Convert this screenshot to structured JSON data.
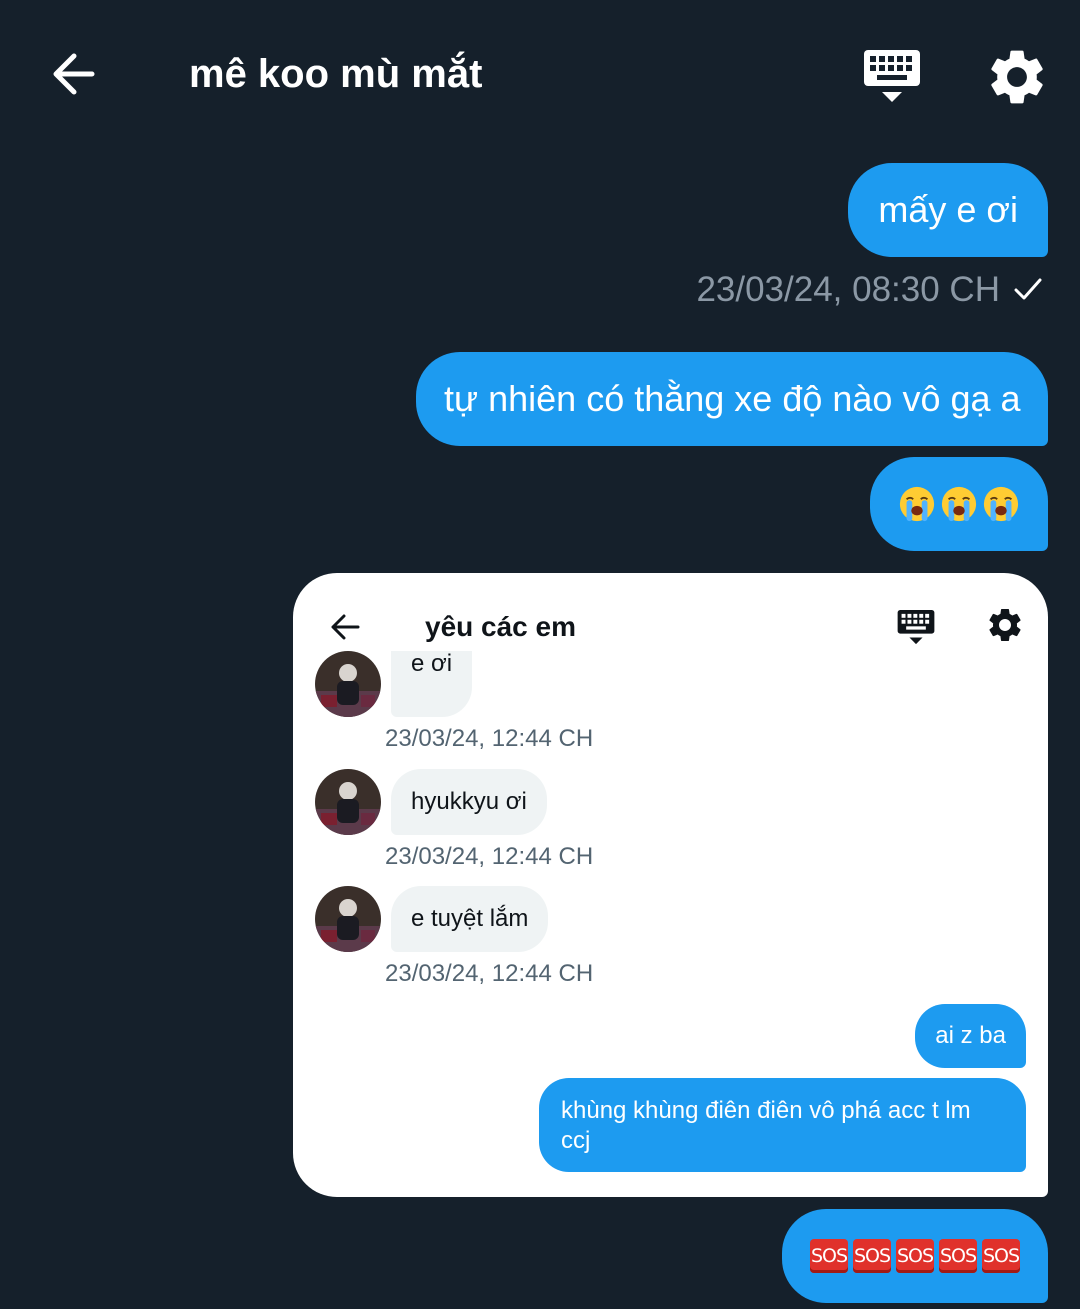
{
  "header": {
    "title": "mê koo mù mắt",
    "back_icon": "arrow-left-icon",
    "keyboard_icon": "keyboard-icon",
    "settings_icon": "gear-icon"
  },
  "messages": [
    {
      "text": "mấy e ơi"
    },
    {
      "timestamp": "23/03/24, 08:30 CH",
      "status_icon": "check-icon"
    },
    {
      "text": "tự nhiên có thằng xe độ nào vô gạ a"
    },
    {
      "emoji": [
        "😭",
        "😭",
        "😭"
      ],
      "emoji_icon": "loudly-crying-face-icon"
    },
    {
      "sos": [
        "SOS",
        "SOS",
        "SOS",
        "SOS",
        "SOS"
      ],
      "emoji_icon": "sos-icon"
    }
  ],
  "embedded": {
    "title": "yêu các em",
    "back_icon": "arrow-left-icon",
    "keyboard_icon": "keyboard-icon",
    "settings_icon": "gear-icon",
    "incoming": [
      {
        "text": "e ơi",
        "time": "23/03/24, 12:44 CH"
      },
      {
        "text": "hyukkyu ơi",
        "time": "23/03/24, 12:44 CH"
      },
      {
        "text": "e tuyệt lắm",
        "time": "23/03/24, 12:44 CH"
      }
    ],
    "outgoing": [
      {
        "text": "ai z ba"
      },
      {
        "text": "khùng khùng điên điên vô phá acc t lm ccj"
      }
    ]
  },
  "colors": {
    "background": "#15202b",
    "bubble_blue": "#1d9bf0",
    "timestamp_gray": "#8b98a5",
    "card_bg": "#ffffff",
    "incoming_bubble": "#eff3f4"
  }
}
